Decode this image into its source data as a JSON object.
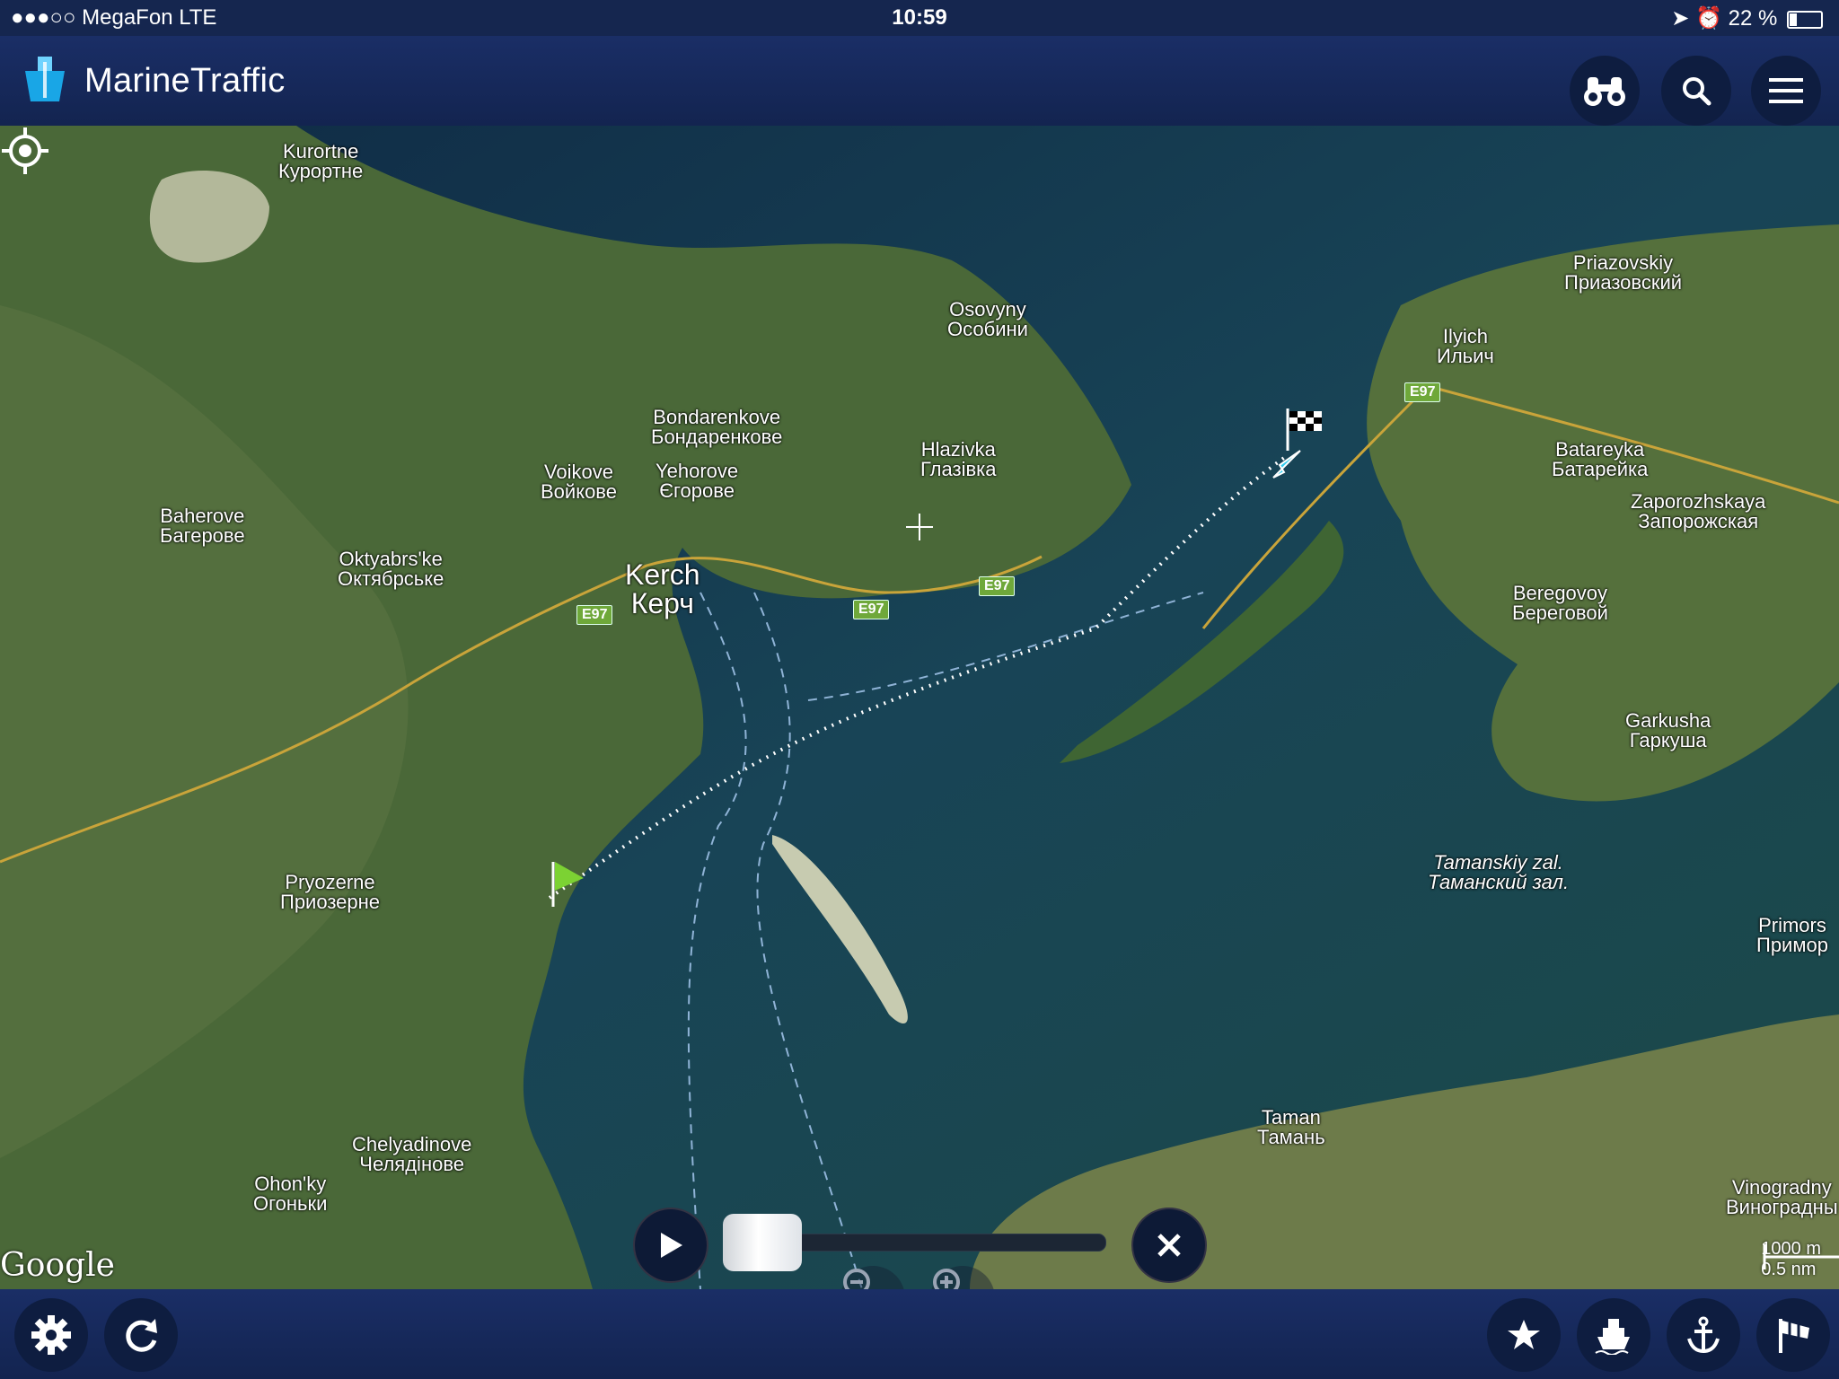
{
  "status": {
    "carrier": "●●●○○ MegaFon   LTE",
    "time": "10:59",
    "battery": "22 %"
  },
  "app": {
    "title": "MarineTraffic",
    "logo_icon": "ship-logo-icon"
  },
  "header_buttons": [
    {
      "icon": "binoculars-icon"
    },
    {
      "icon": "search-icon"
    },
    {
      "icon": "menu-icon"
    }
  ],
  "map": {
    "labels": [
      {
        "lat": "Kurortne",
        "cyr": "Курортне"
      },
      {
        "lat": "Osovyny",
        "cyr": "Особини"
      },
      {
        "lat": "Bondarenkove",
        "cyr": "Бондаренкове"
      },
      {
        "lat": "Voikove",
        "cyr": "Войкове"
      },
      {
        "lat": "Yehorove",
        "cyr": "Єгорове"
      },
      {
        "lat": "Hlazivka",
        "cyr": "Глазівка"
      },
      {
        "lat": "Baherove",
        "cyr": "Багерове"
      },
      {
        "lat": "Oktyabrs'ke",
        "cyr": "Октябрське"
      },
      {
        "lat": "Kerch",
        "cyr": "Керч"
      },
      {
        "lat": "Pryozerne",
        "cyr": "Приозерне"
      },
      {
        "lat": "Chelyadinove",
        "cyr": "Челядінове"
      },
      {
        "lat": "Ohon'ky",
        "cyr": "Огоньки"
      },
      {
        "lat": "Priazovskiy",
        "cyr": "Приазовский"
      },
      {
        "lat": "Ilyich",
        "cyr": "Ильич"
      },
      {
        "lat": "Batareyka",
        "cyr": "Батарейка"
      },
      {
        "lat": "Zaporozhskaya",
        "cyr": "Запорожская"
      },
      {
        "lat": "Beregovoy",
        "cyr": "Береговой"
      },
      {
        "lat": "Garkusha",
        "cyr": "Гаркуша"
      },
      {
        "lat": "Tamanskiy zal.",
        "cyr": "Таманский зал."
      },
      {
        "lat": "Primors",
        "cyr": "Примор"
      },
      {
        "lat": "Taman",
        "cyr": "Тамань"
      },
      {
        "lat": "Vinogradny",
        "cyr": "Виноградны"
      }
    ],
    "road_label": "E97",
    "scale": {
      "metric": "1000 m",
      "nautical": "0.5 nm"
    },
    "attribution": "Google"
  },
  "playback": {
    "progress": 0.0
  },
  "bottom_buttons": [
    {
      "icon": "settings-gear-icon"
    },
    {
      "icon": "refresh-icon"
    },
    {
      "icon": "star-icon"
    },
    {
      "icon": "ship-icon"
    },
    {
      "icon": "anchor-icon"
    },
    {
      "icon": "wind-flag-icon"
    }
  ],
  "colors": {
    "bar": "#1a2e66",
    "sea": "#163a4c",
    "land": "#4f6b3c",
    "track": "#ffffff",
    "vessel": "#33ccee"
  }
}
